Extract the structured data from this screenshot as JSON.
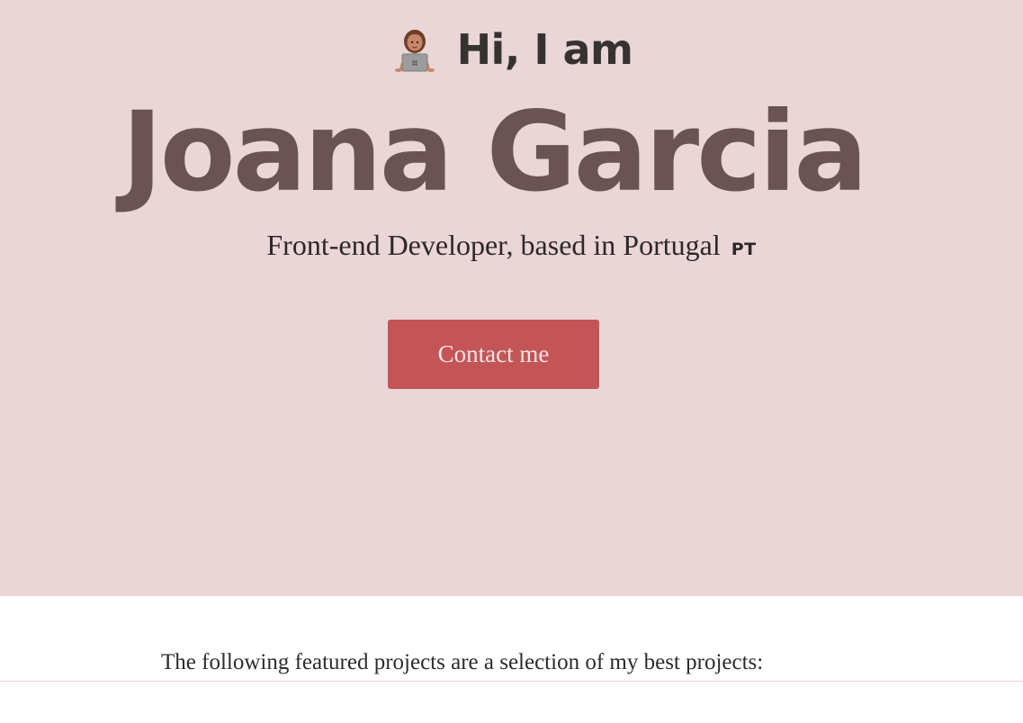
{
  "hero": {
    "greeting": "Hi, I am",
    "avatar_icon": "woman-technologist-icon",
    "name": "Joana Garcia",
    "role": "Front-end Developer, based in Portugal",
    "country_code": "PT",
    "contact_label": "Contact me",
    "colors": {
      "background": "#ead6d6",
      "name": "#6a5353",
      "button": "#c35557",
      "button_text": "#f7e3e3"
    }
  },
  "projects": {
    "intro": "The following featured projects are a selection of my best projects:"
  }
}
